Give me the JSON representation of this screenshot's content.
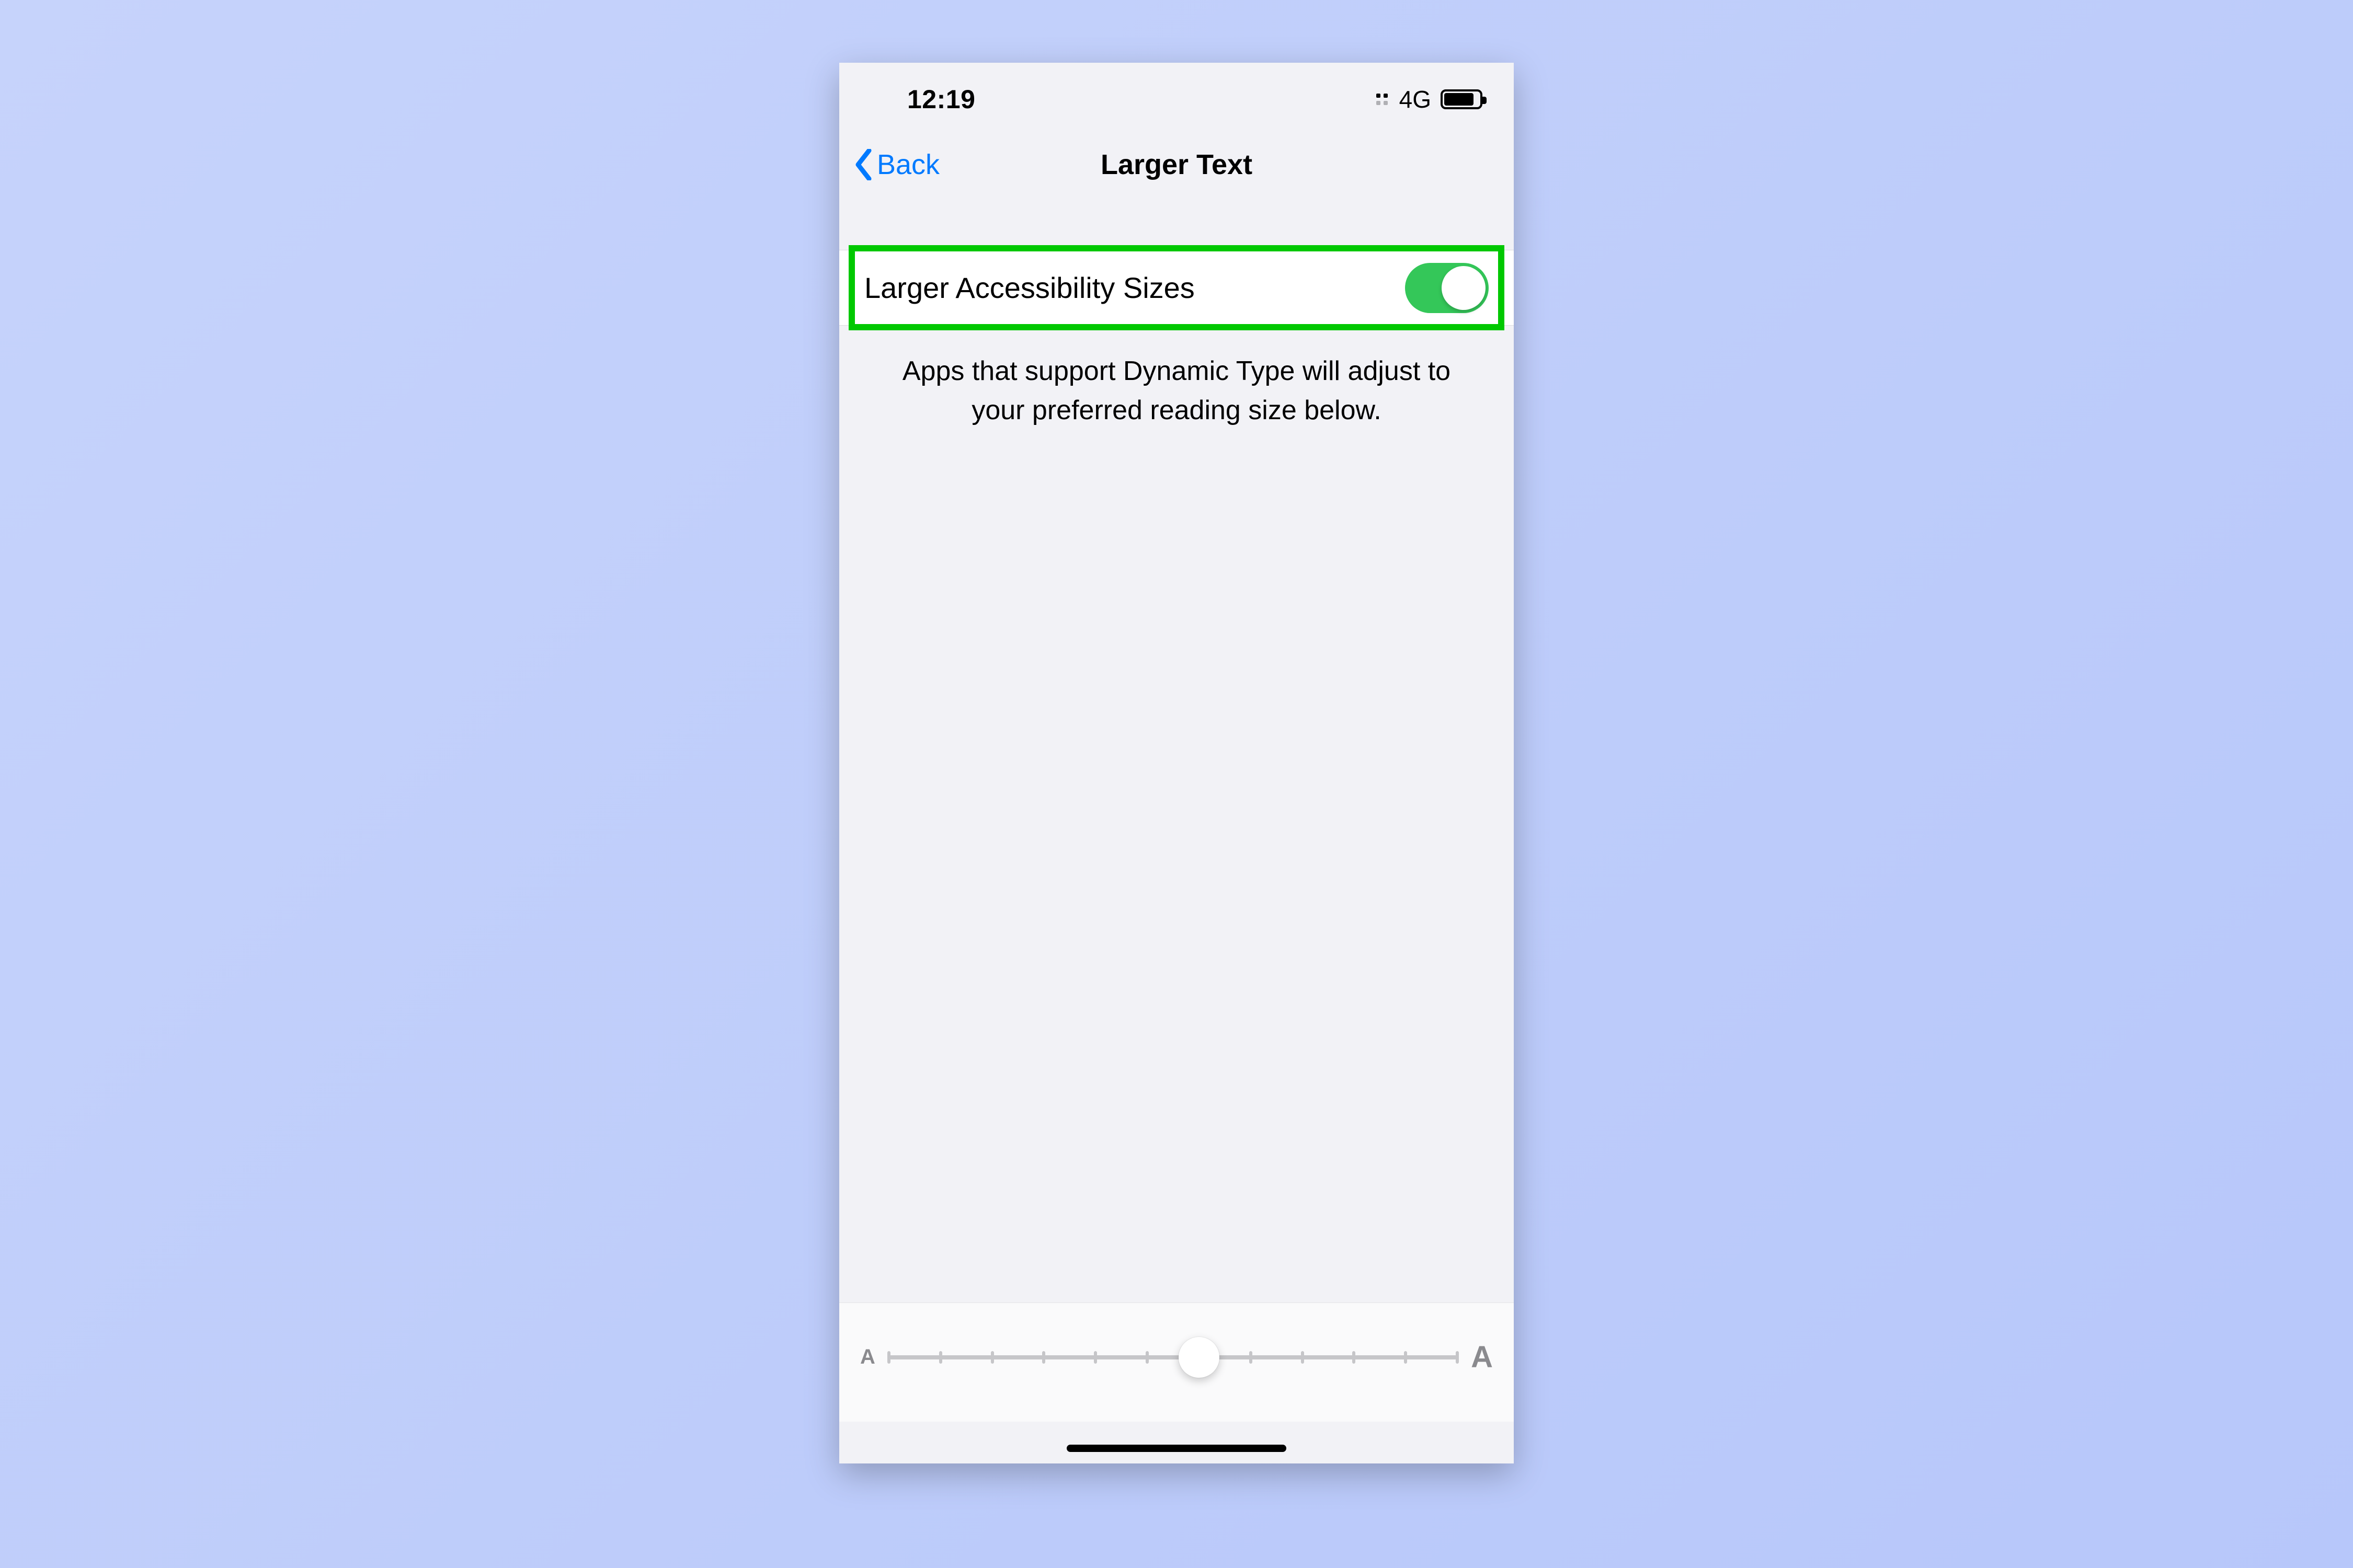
{
  "status": {
    "time": "12:19",
    "network_label": "4G",
    "battery_pct": 78
  },
  "nav": {
    "back_label": "Back",
    "title": "Larger Text"
  },
  "setting": {
    "larger_accessibility_sizes": {
      "label": "Larger Accessibility Sizes",
      "on": true
    },
    "footer": "Apps that support Dynamic Type will adjust to your preferred reading size below."
  },
  "slider": {
    "small_glyph": "A",
    "large_glyph": "A",
    "steps": 12,
    "value_index": 6
  },
  "colors": {
    "tint": "#007aff",
    "switch_on": "#34c759",
    "highlight": "#00c800"
  }
}
